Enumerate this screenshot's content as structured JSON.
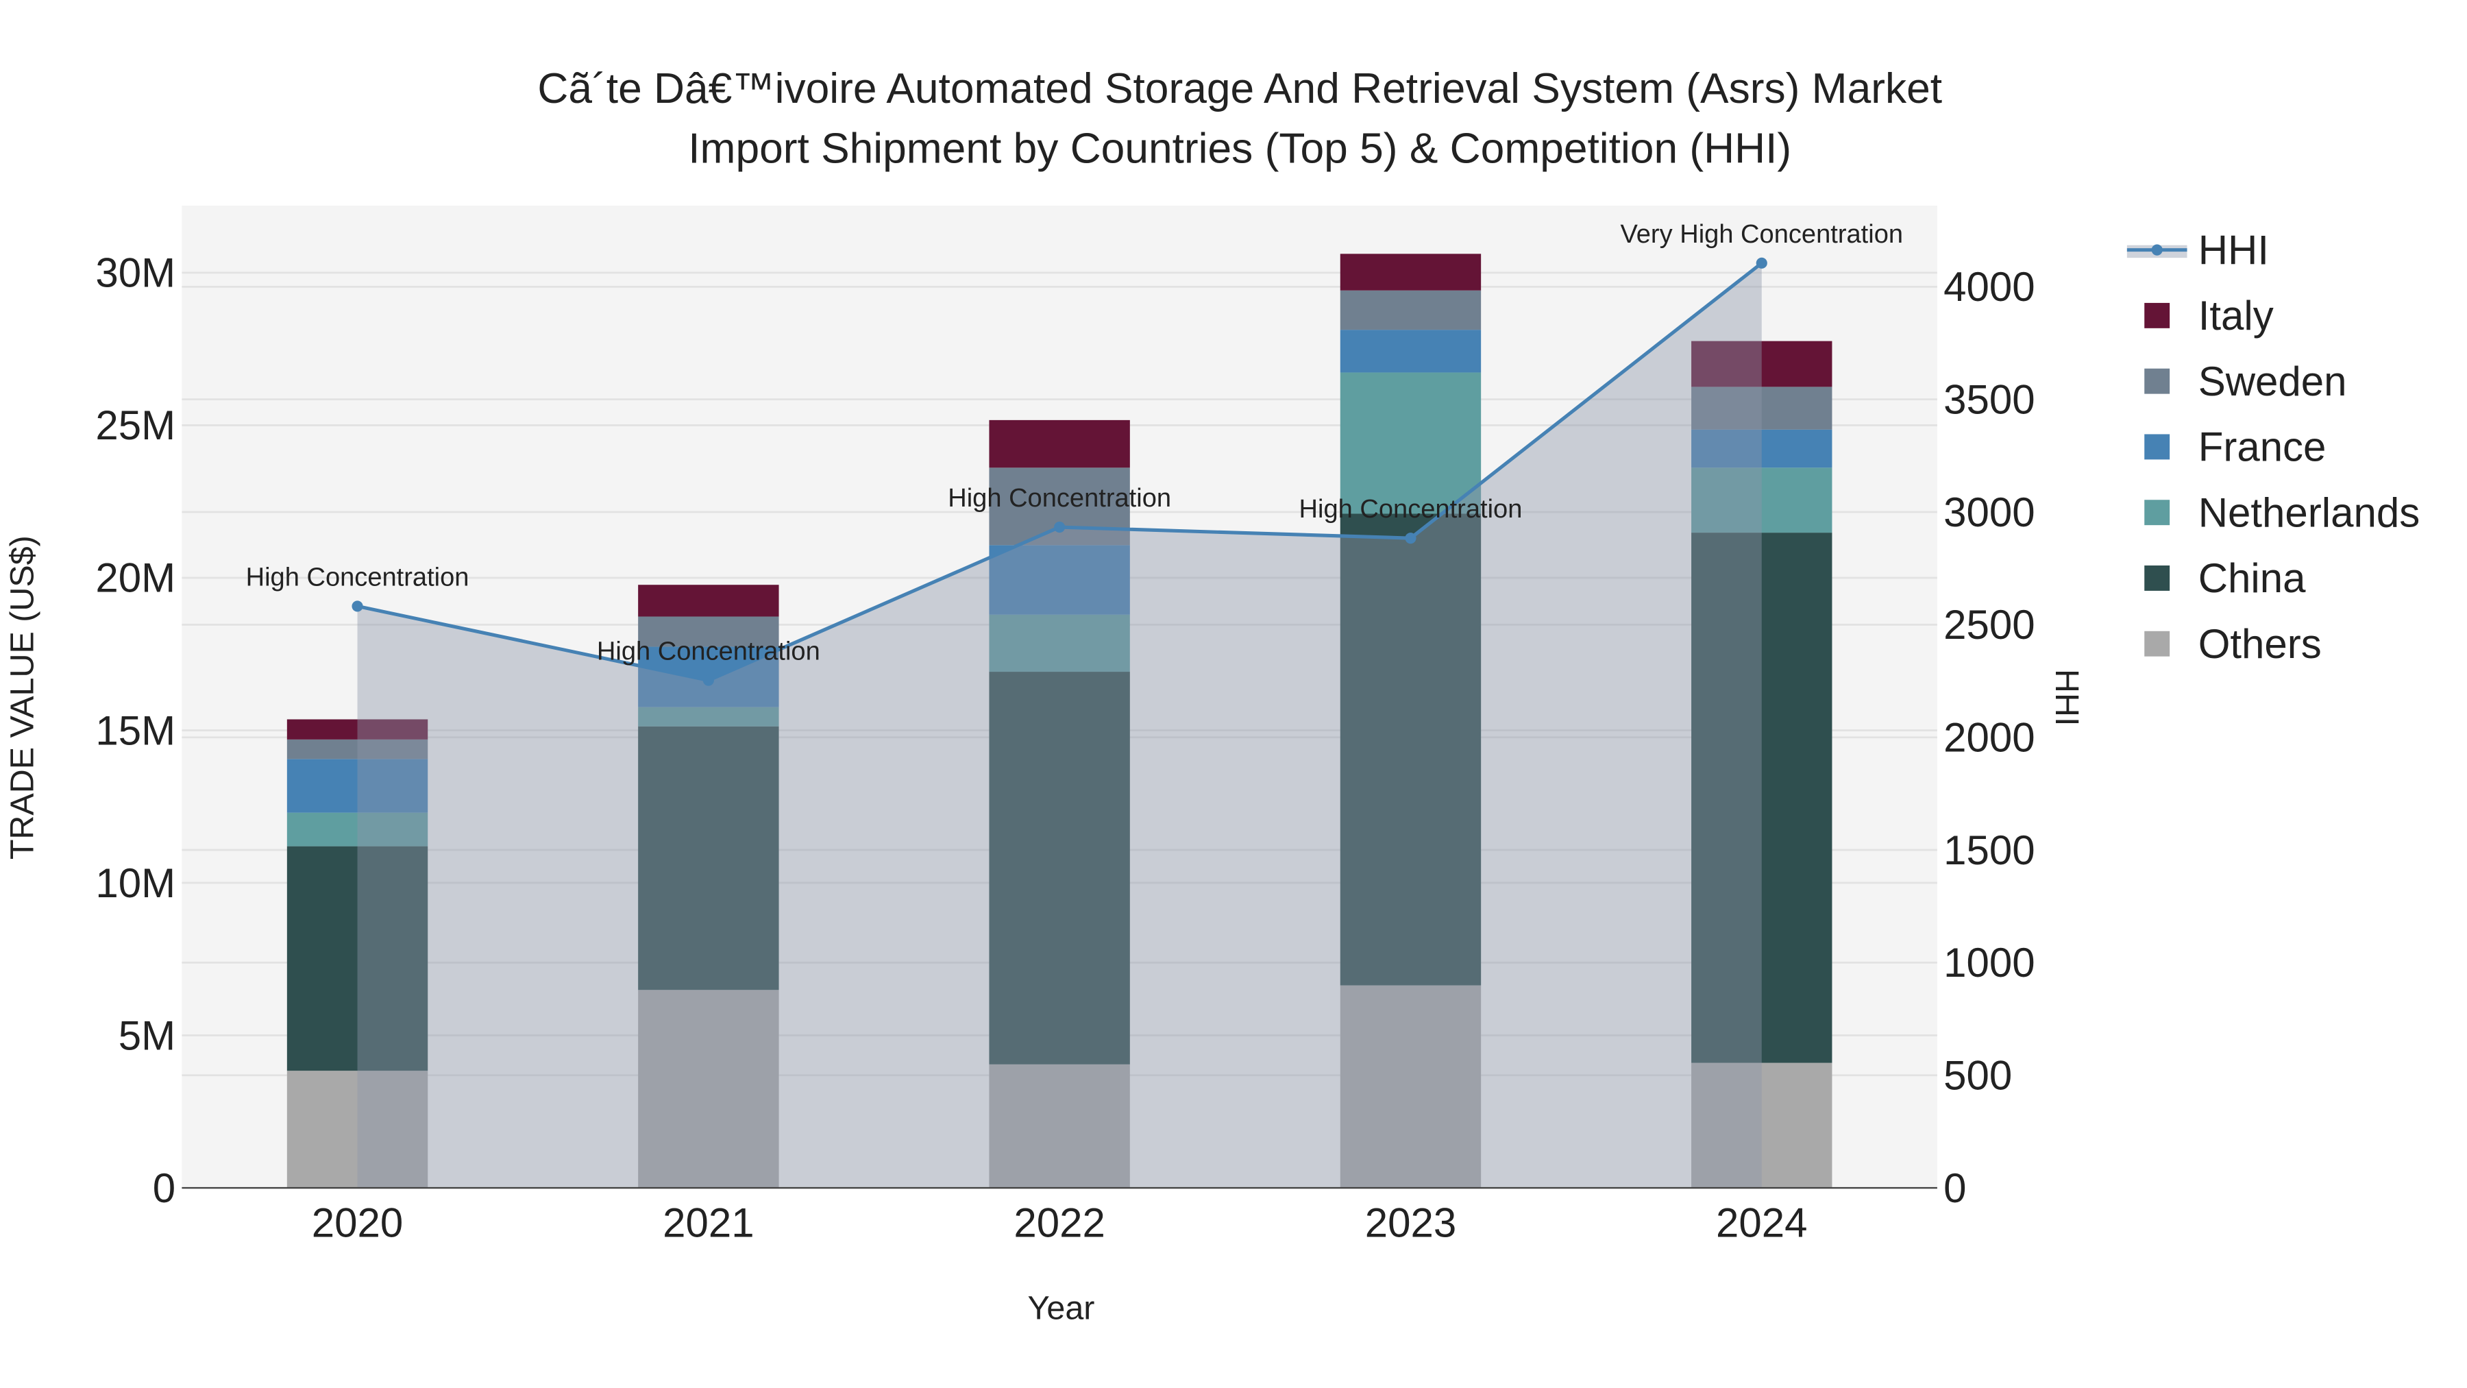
{
  "chart_data": {
    "type": "bar",
    "stacked": true,
    "title_line1": "Cã´te Dâ€™ivoire Automated Storage And Retrieval System (Asrs) Market",
    "title_line2": "Import Shipment by Countries (Top 5) & Competition (HHI)",
    "xlabel": "Year",
    "ylabel": "TRADE VALUE (US$)",
    "y2label": "HHI",
    "categories": [
      "2020",
      "2021",
      "2022",
      "2023",
      "2024"
    ],
    "ylim": [
      0,
      32200000
    ],
    "y2lim": [
      0,
      4360
    ],
    "yticks": [
      0,
      5000000,
      10000000,
      15000000,
      20000000,
      25000000,
      30000000
    ],
    "ytick_labels": [
      "0",
      "5M",
      "10M",
      "15M",
      "20M",
      "25M",
      "30M"
    ],
    "y2ticks": [
      0,
      500,
      1000,
      1500,
      2000,
      2500,
      3000,
      3500,
      4000
    ],
    "y2tick_labels": [
      "0",
      "500",
      "1000",
      "1500",
      "2000",
      "2500",
      "3000",
      "3500",
      "4000"
    ],
    "grid": true,
    "legend_position": "right",
    "series": [
      {
        "name": "Others",
        "color": "#A9A9A9",
        "values": [
          3840000,
          6490000,
          4050000,
          6640000,
          4100000
        ]
      },
      {
        "name": "China",
        "color": "#2F4F4F",
        "values": [
          7360000,
          8640000,
          12870000,
          15460000,
          17380000
        ]
      },
      {
        "name": "Netherlands",
        "color": "#5F9EA0",
        "values": [
          1100000,
          630000,
          1870000,
          4630000,
          2130000
        ]
      },
      {
        "name": "France",
        "color": "#4682B4",
        "values": [
          1760000,
          1980000,
          2280000,
          1400000,
          1250000
        ]
      },
      {
        "name": "Sweden",
        "color": "#708090",
        "values": [
          640000,
          990000,
          2540000,
          1290000,
          1400000
        ]
      },
      {
        "name": "Italy",
        "color": "#641436",
        "values": [
          660000,
          1040000,
          1560000,
          1200000,
          1500000
        ]
      }
    ],
    "hhi": {
      "name": "HHI",
      "color": "#4682B4",
      "values": [
        2582,
        2253,
        2933,
        2884,
        4105
      ],
      "annotations": [
        "High Concentration",
        "High Concentration",
        "High Concentration",
        "High Concentration",
        "Very High Concentration"
      ]
    },
    "legend_order": [
      "HHI",
      "Italy",
      "Sweden",
      "France",
      "Netherlands",
      "China",
      "Others"
    ]
  }
}
